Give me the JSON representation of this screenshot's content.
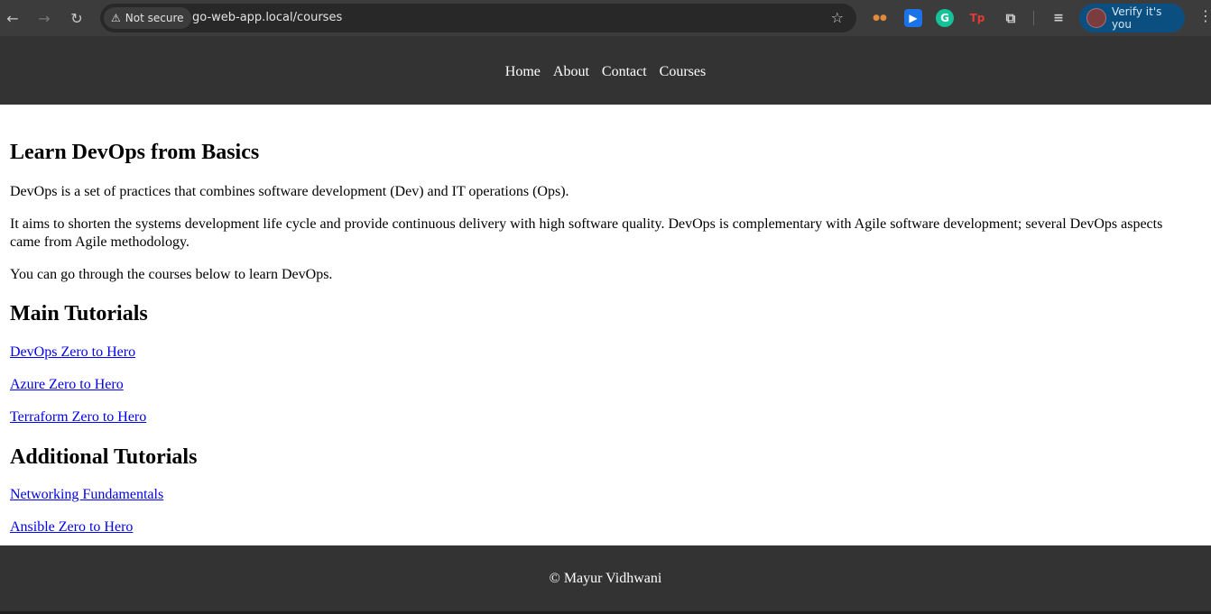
{
  "browser": {
    "security_label": "Not secure",
    "url": "go-web-app.local/courses",
    "verify_label": "Verify it's you",
    "extensions": [
      {
        "name": "eyes-extension-icon",
        "glyph": "●●",
        "color": "#e08a3c"
      },
      {
        "name": "reader-extension-icon",
        "glyph": "▶",
        "color": "#1a73e8"
      },
      {
        "name": "grammarly-extension-icon",
        "glyph": "G",
        "color": "#15c39a"
      },
      {
        "name": "tp-extension-icon",
        "glyph": "Tp",
        "color": "#e53935"
      },
      {
        "name": "puzzle-extensions-icon",
        "glyph": "⧉",
        "color": "#d0d0d0"
      }
    ]
  },
  "nav": {
    "home": "Home",
    "about": "About",
    "contact": "Contact",
    "courses": "Courses"
  },
  "main": {
    "title": "Learn DevOps from Basics",
    "para1": "DevOps is a set of practices that combines software development (Dev) and IT operations (Ops).",
    "para2": "It aims to shorten the systems development life cycle and provide continuous delivery with high software quality. DevOps is complementary with Agile software development; several DevOps aspects came from Agile methodology.",
    "para3": "You can go through the courses below to learn DevOps.",
    "main_tutorials_heading": "Main Tutorials",
    "main_tutorials": [
      "DevOps Zero to Hero",
      "Azure Zero to Hero",
      "Terraform Zero to Hero"
    ],
    "additional_heading": "Additional Tutorials",
    "additional_tutorials": [
      "Networking Fundamentals",
      "Ansible Zero to Hero"
    ]
  },
  "footer": {
    "copyright": "© Mayur Vidhwani"
  },
  "colors": {
    "header_bg": "#333333",
    "link": "#0000ee"
  }
}
